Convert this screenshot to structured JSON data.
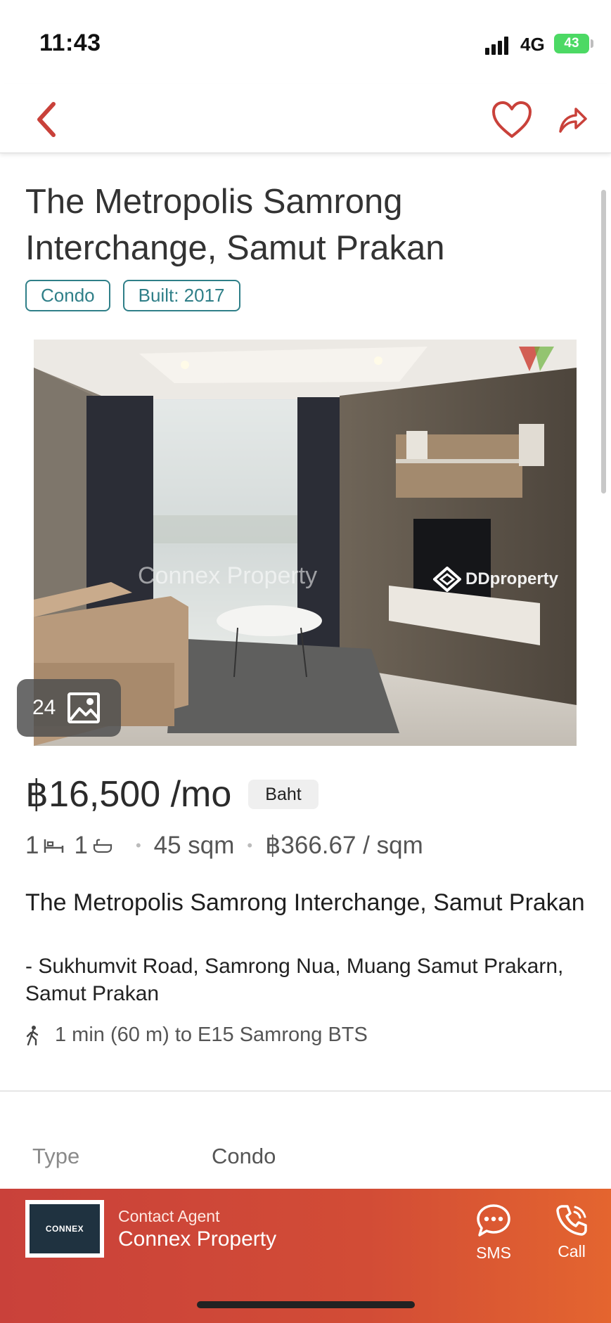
{
  "status_bar": {
    "time": "11:43",
    "network": "4G",
    "battery": "43"
  },
  "nav": {
    "icons": [
      "back-arrow-icon",
      "heart-icon",
      "share-icon"
    ],
    "accent_color": "#c9413a"
  },
  "listing": {
    "title": "The Metropolis Samrong Interchange, Samut Prakan",
    "tags": [
      "Condo",
      "Built: 2017"
    ],
    "photo": {
      "count": "24",
      "watermarks": [
        "Connex Property",
        "DDproperty"
      ]
    },
    "price": "฿16,500 /mo",
    "currency_label": "Baht",
    "bedrooms": "1",
    "bathrooms": "1",
    "size": "45 sqm",
    "price_per_sqm": "฿366.67 / sqm",
    "project_name": "The Metropolis Samrong Interchange, Samut Prakan",
    "address": "- Sukhumvit Road, Samrong Nua, Muang Samut Prakarn, Samut Prakan",
    "transit": "1 min (60 m) to E15 Samrong BTS"
  },
  "details": {
    "type_label": "Type",
    "type_value": "Condo"
  },
  "agent": {
    "caption": "Contact Agent",
    "name": "Connex Property",
    "logo_text": "CONNEX",
    "sms_label": "SMS",
    "call_label": "Call"
  }
}
